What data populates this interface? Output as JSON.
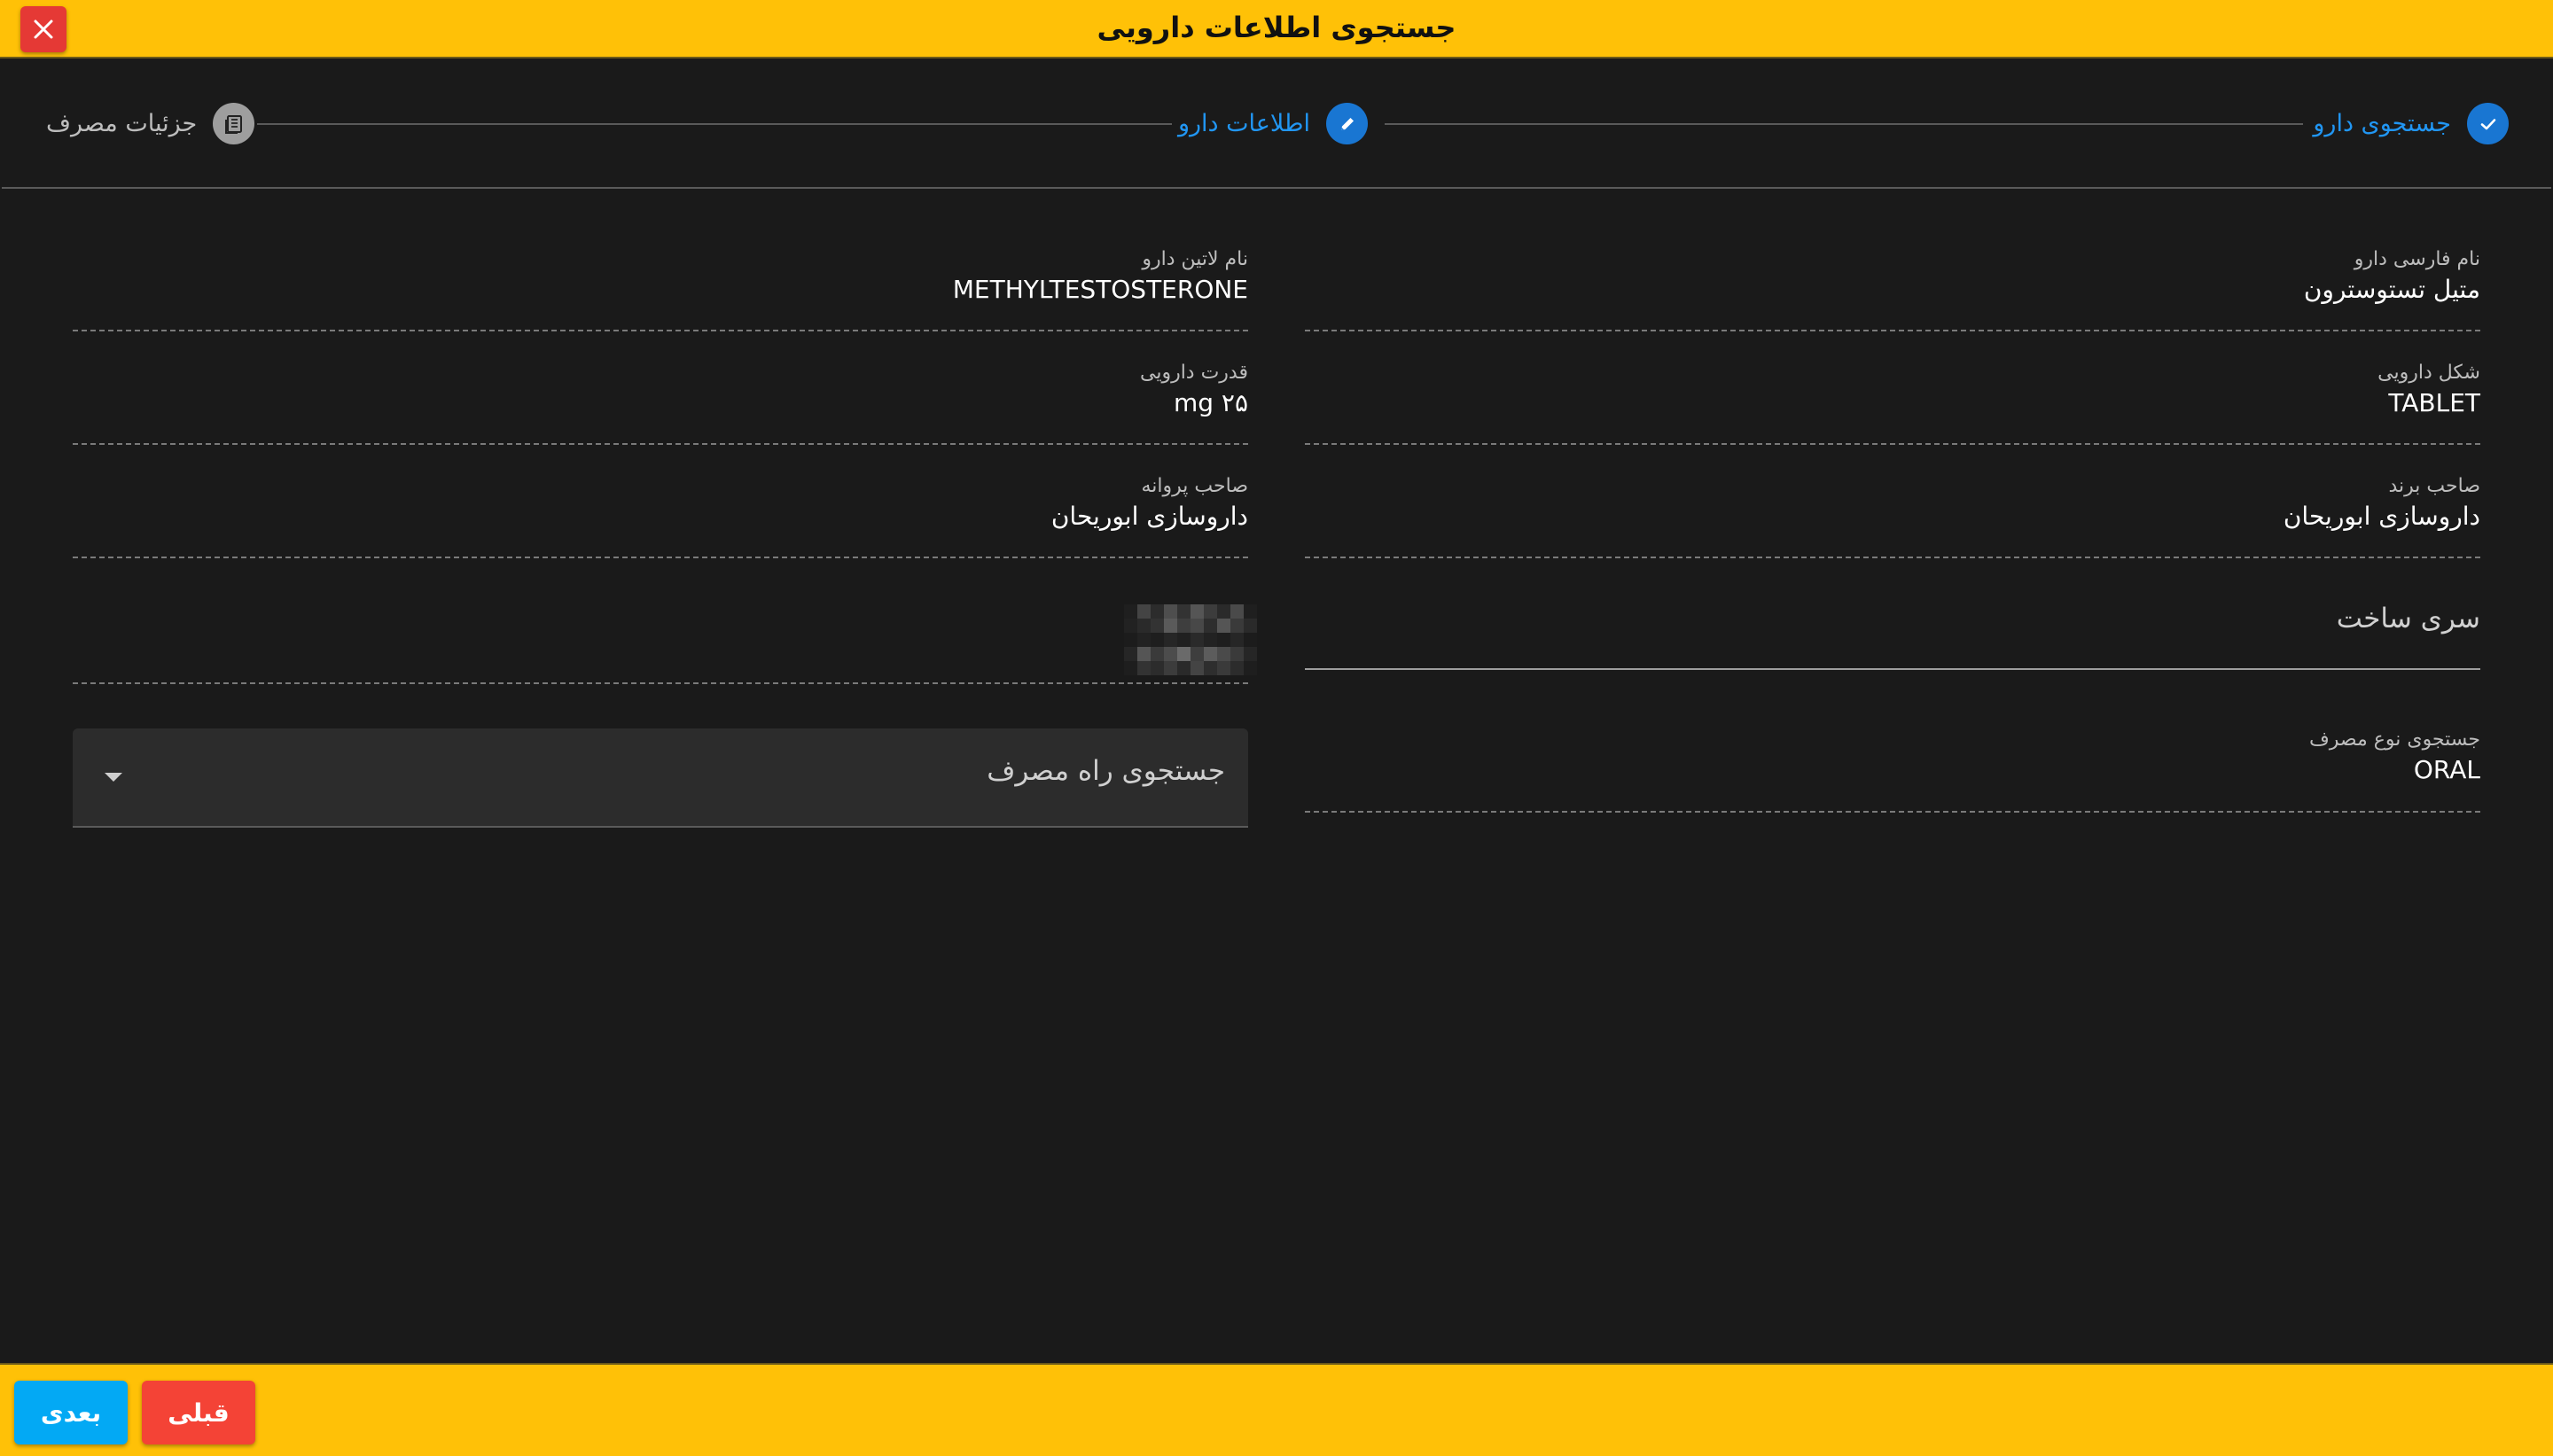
{
  "window": {
    "title": "جستجوی اطلاعات دارویی",
    "close_icon": "close-icon"
  },
  "stepper": {
    "steps": [
      {
        "label": "جستجوی دارو",
        "state": "completed",
        "icon": "check-icon",
        "color": "#1976d2"
      },
      {
        "label": "اطلاعات دارو",
        "state": "active",
        "icon": "pencil-icon",
        "color": "#1976d2"
      },
      {
        "label": "جزئیات مصرف",
        "state": "pending",
        "icon": "notebook-icon",
        "color": "#9e9e9e"
      }
    ]
  },
  "form": {
    "persian_name": {
      "label": "نام فارسی دارو",
      "value": "متیل تستوسترون"
    },
    "latin_name": {
      "label": "نام لاتین دارو",
      "value": "METHYLTESTOSTERONE"
    },
    "dosage_form": {
      "label": "شکل دارویی",
      "value": "TABLET"
    },
    "strength": {
      "label": "قدرت دارویی",
      "value": "۲۵ mg"
    },
    "brand_owner": {
      "label": "صاحب برند",
      "value": "داروسازی ابوریحان"
    },
    "license_owner": {
      "label": "صاحب پروانه",
      "value": "داروسازی ابوریحان"
    },
    "batch_number": {
      "placeholder": "سری ساخت"
    },
    "consumption_type": {
      "label": "جستجوی نوع مصرف",
      "value": "ORAL"
    },
    "route": {
      "placeholder": "جستجوی راه مصرف"
    }
  },
  "footer": {
    "next_label": "بعدی",
    "prev_label": "قبلی"
  },
  "colors": {
    "accent_bar": "#ffc107",
    "primary": "#1976d2",
    "next_button": "#03a9f4",
    "prev_button": "#f44336",
    "close_button": "#e53935"
  }
}
